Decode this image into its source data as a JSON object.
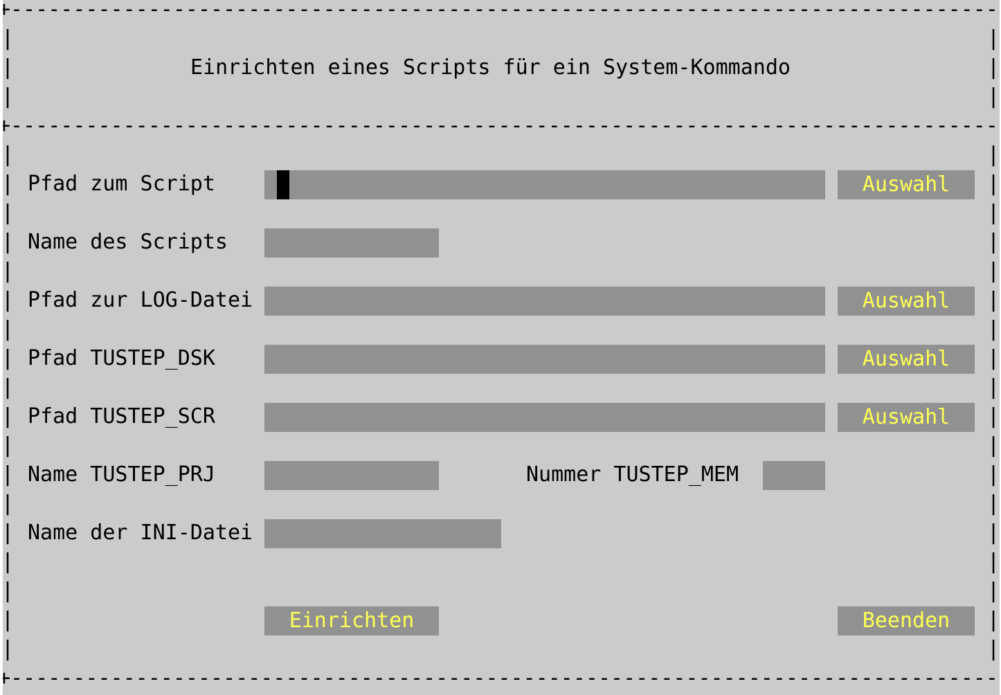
{
  "border": {
    "rule_top": "+--------------------------------------------------------------------------------+",
    "rule_mid": "+--------------------------------------------------------------------------------+",
    "rule_bottom": "+--------------------------------------------------------------------------------+",
    "side_char": "|"
  },
  "dialog": {
    "title": "Einrichten eines Scripts für ein System-Kommando"
  },
  "form": {
    "script_path": {
      "label": "Pfad zum Script",
      "value": "",
      "button": "Auswahl",
      "has_cursor": true
    },
    "script_name": {
      "label": "Name des Scripts",
      "value": ""
    },
    "log_path": {
      "label": "Pfad zur LOG-Datei",
      "value": "",
      "button": "Auswahl"
    },
    "tustep_dsk": {
      "label": "Pfad TUSTEP_DSK",
      "value": "",
      "button": "Auswahl"
    },
    "tustep_scr": {
      "label": "Pfad TUSTEP_SCR",
      "value": "",
      "button": "Auswahl"
    },
    "tustep_prj": {
      "label": "Name TUSTEP_PRJ",
      "value": ""
    },
    "tustep_mem": {
      "label": "Nummer TUSTEP_MEM",
      "value": ""
    },
    "ini_name": {
      "label": "Name der INI-Datei",
      "value": ""
    }
  },
  "actions": {
    "submit_label": "Einrichten",
    "quit_label": "Beenden"
  },
  "colors": {
    "background": "#cbcbcb",
    "field": "#919191",
    "button_text": "#ffff55",
    "text": "#000000"
  }
}
